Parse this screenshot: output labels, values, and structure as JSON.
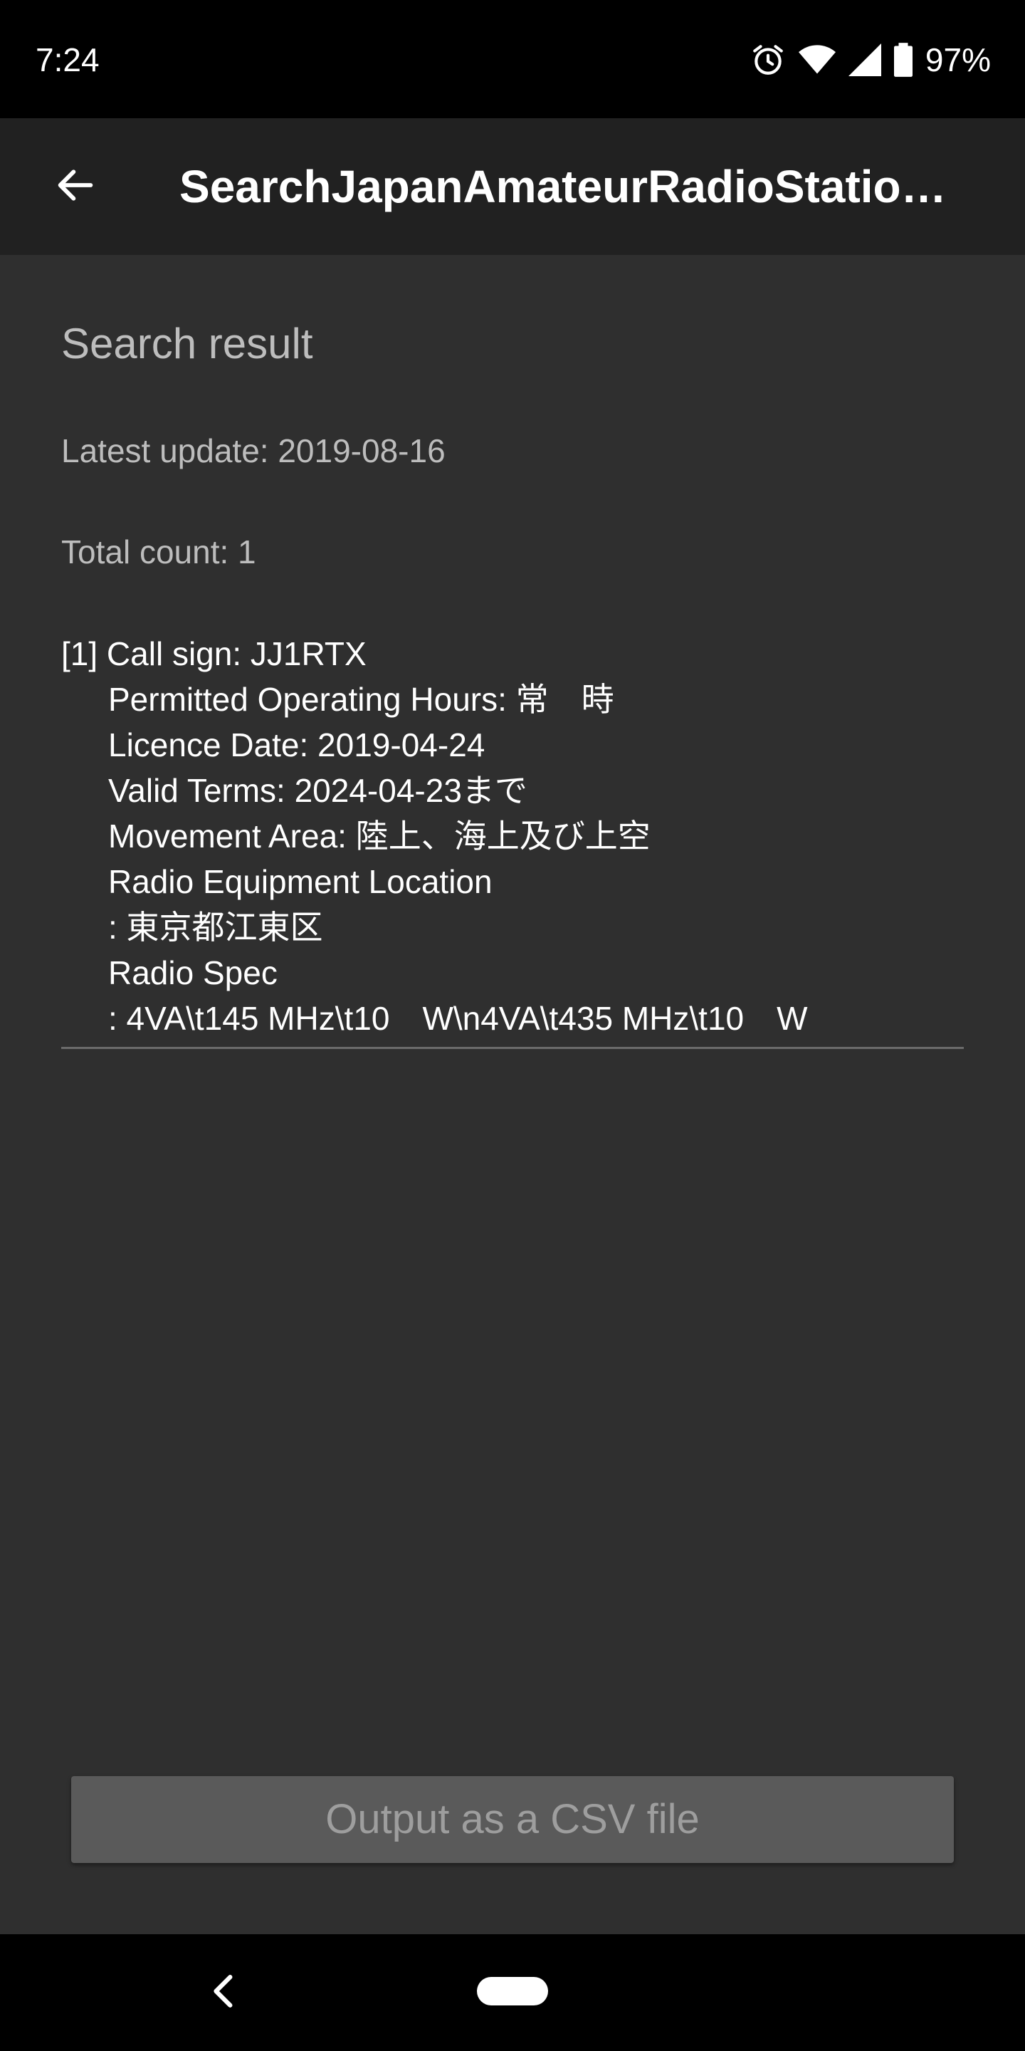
{
  "status_bar": {
    "time": "7:24",
    "battery_pct": "97%",
    "icons": [
      "alarm-icon",
      "wifi-icon",
      "signal-icon",
      "battery-icon"
    ]
  },
  "app_bar": {
    "title": "SearchJapanAmateurRadioStatio…",
    "back_icon": "arrow-back-icon"
  },
  "main": {
    "section_title": "Search result",
    "latest_update": "Latest update: 2019-08-16",
    "total_count": "Total count: 1",
    "results": [
      {
        "call_sign": "[1] Call sign: JJ1RTX",
        "operating_hours": "Permitted Operating Hours: 常　時",
        "licence_date": "Licence Date: 2019-04-24",
        "valid_terms": "Valid Terms: 2024-04-23まで",
        "movement_area": "Movement Area: 陸上、海上及び上空",
        "equipment_location_label": "Radio Equipment Location",
        "equipment_location_value": ": 東京都江東区",
        "radio_spec_label": "Radio Spec",
        "radio_spec_value": ": 4VA\\t145 MHz\\t10　W\\n4VA\\t435 MHz\\t10　W"
      }
    ],
    "csv_button_label": "Output as a CSV file"
  },
  "nav_bar": {
    "back_icon": "nav-back-icon",
    "home_icon": "nav-home-pill-icon"
  },
  "colors": {
    "background": "#2f2f2f",
    "app_bar": "#212121",
    "status_bar": "#000000",
    "button": "#5a5a5a",
    "secondary_text": "#bdbdbd",
    "primary_text": "#ffffff"
  }
}
